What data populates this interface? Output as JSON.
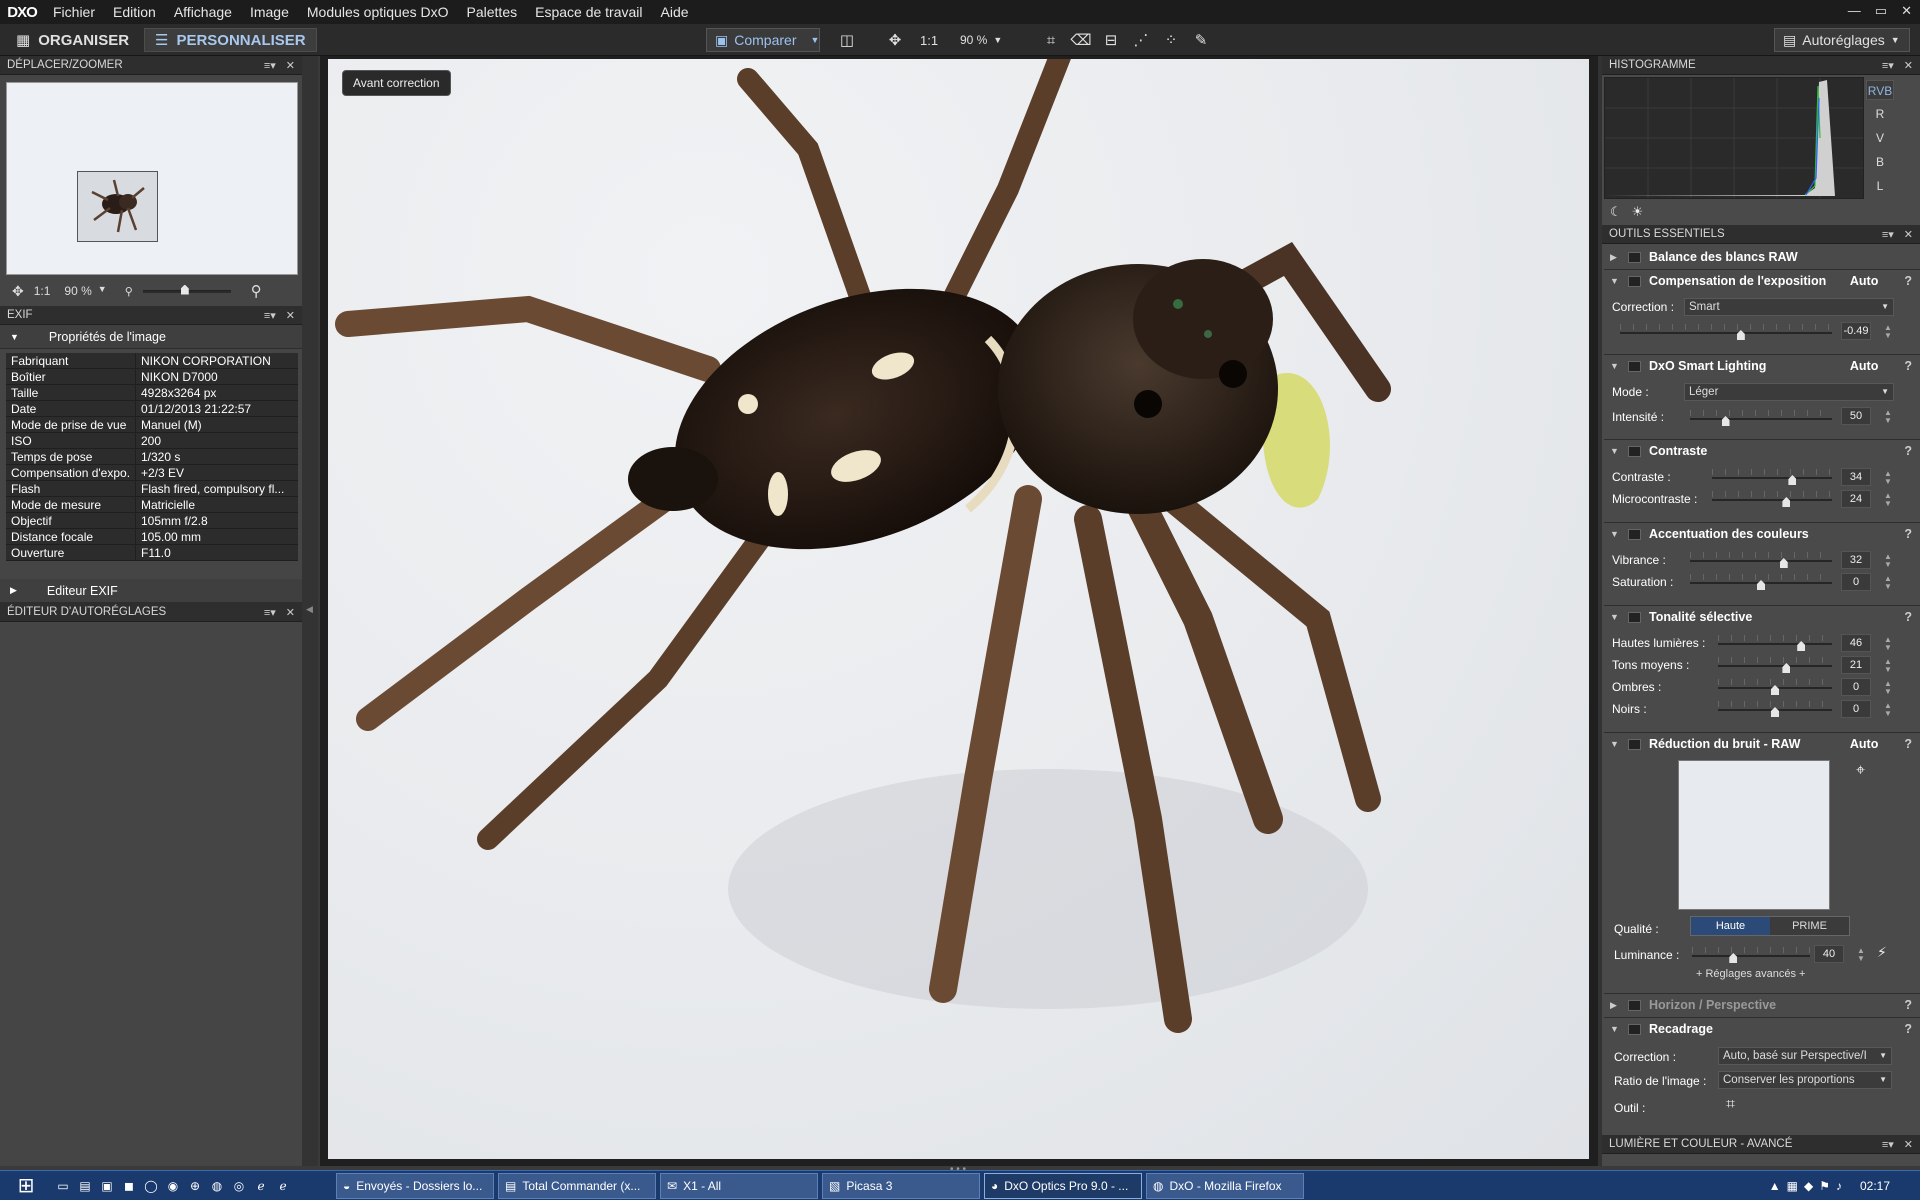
{
  "app": {
    "logo": "DXO"
  },
  "menu": [
    "Fichier",
    "Edition",
    "Affichage",
    "Image",
    "Modules optiques DxO",
    "Palettes",
    "Espace de travail",
    "Aide"
  ],
  "window_controls": [
    "—",
    "▭",
    "✕"
  ],
  "toolbar": {
    "organiser": "ORGANISER",
    "personnaliser": "PERSONNALISER",
    "comparer": "Comparer",
    "zoom_1_1": "1:1",
    "zoom": "90 %",
    "autoreglages": "Autoréglages"
  },
  "nav": {
    "title": "DÉPLACER/ZOOMER",
    "one_to_one": "1:1",
    "zoom": "90 %"
  },
  "exif": {
    "title": "EXIF",
    "section": "Propriétés de l'image",
    "rows": [
      {
        "k": "Fabriquant",
        "v": "NIKON CORPORATION"
      },
      {
        "k": "Boîtier",
        "v": "NIKON D7000"
      },
      {
        "k": "Taille",
        "v": "4928x3264 px"
      },
      {
        "k": "Date",
        "v": "01/12/2013 21:22:57"
      },
      {
        "k": "Mode de prise de vue",
        "v": "Manuel (M)"
      },
      {
        "k": "ISO",
        "v": "200"
      },
      {
        "k": "Temps de pose",
        "v": "1/320 s"
      },
      {
        "k": "Compensation d'expo.",
        "v": "+2/3 EV"
      },
      {
        "k": "Flash",
        "v": "Flash fired, compulsory fl..."
      },
      {
        "k": "Mode de mesure",
        "v": "Matricielle"
      },
      {
        "k": "Objectif",
        "v": "105mm f/2.8"
      },
      {
        "k": "Distance focale",
        "v": "105.00 mm"
      },
      {
        "k": "Ouverture",
        "v": "F11.0"
      }
    ],
    "editor": "Editeur EXIF",
    "autoreglages_editor": "ÉDITEUR D'AUTORÉGLAGES"
  },
  "viewer": {
    "badge": "Avant correction"
  },
  "histogram": {
    "title": "HISTOGRAMME",
    "channels": [
      "RVB",
      "R",
      "V",
      "B",
      "L"
    ],
    "selected": "RVB"
  },
  "tools": {
    "title": "OUTILS ESSENTIELS",
    "wb": "Balance des blancs RAW",
    "expo": {
      "name": "Compensation de l'exposition",
      "auto": "Auto",
      "q": "?",
      "correction_label": "Correction :",
      "correction": "Smart",
      "value": "-0.49",
      "level": 0.57
    },
    "smart": {
      "name": "DxO Smart Lighting",
      "auto": "Auto",
      "q": "?",
      "mode_label": "Mode :",
      "mode": "Léger",
      "intensity_label": "Intensité :",
      "intensity": "50",
      "level": 0.25
    },
    "contrast": {
      "name": "Contraste",
      "q": "?",
      "contraste_label": "Contraste :",
      "contraste": "34",
      "contraste_level": 0.67,
      "micro_label": "Microcontraste :",
      "micro": "24",
      "micro_level": 0.62
    },
    "couleurs": {
      "name": "Accentuation des couleurs",
      "q": "?",
      "vibrance_label": "Vibrance :",
      "vibrance": "32",
      "vibrance_level": 0.66,
      "saturation_label": "Saturation :",
      "saturation": "0",
      "saturation_level": 0.5
    },
    "tonalite": {
      "name": "Tonalité sélective",
      "q": "?",
      "rows": [
        {
          "label": "Hautes lumières :",
          "value": "46",
          "level": 0.73
        },
        {
          "label": "Tons moyens :",
          "value": "21",
          "level": 0.6
        },
        {
          "label": "Ombres :",
          "value": "0",
          "level": 0.5
        },
        {
          "label": "Noirs :",
          "value": "0",
          "level": 0.5
        }
      ]
    },
    "bruit": {
      "name": "Réduction du bruit - RAW",
      "auto": "Auto",
      "q": "?",
      "qualite_label": "Qualité :",
      "haute": "Haute",
      "prime": "PRIME",
      "luminance_label": "Luminance :",
      "luminance": "40",
      "luminance_level": 0.35,
      "avances": "+ Réglages avancés +"
    },
    "horizon": {
      "name": "Horizon / Perspective",
      "q": "?"
    },
    "recadrage": {
      "name": "Recadrage",
      "q": "?",
      "correction_label": "Correction :",
      "correction": "Auto, basé sur Perspective/I",
      "ratio_label": "Ratio de l'image :",
      "ratio": "Conserver les proportions",
      "outil_label": "Outil :"
    }
  },
  "lumiere": "LUMIÈRE ET COULEUR - AVANCÉ",
  "taskbar": {
    "tasks": [
      "Envoyés - Dossiers lo...",
      "Total Commander (x...",
      "X1 - All",
      "Picasa 3",
      "DxO Optics Pro 9.0 - ...",
      "DxO - Mozilla Firefox"
    ],
    "active": 4,
    "time": "02:17"
  }
}
